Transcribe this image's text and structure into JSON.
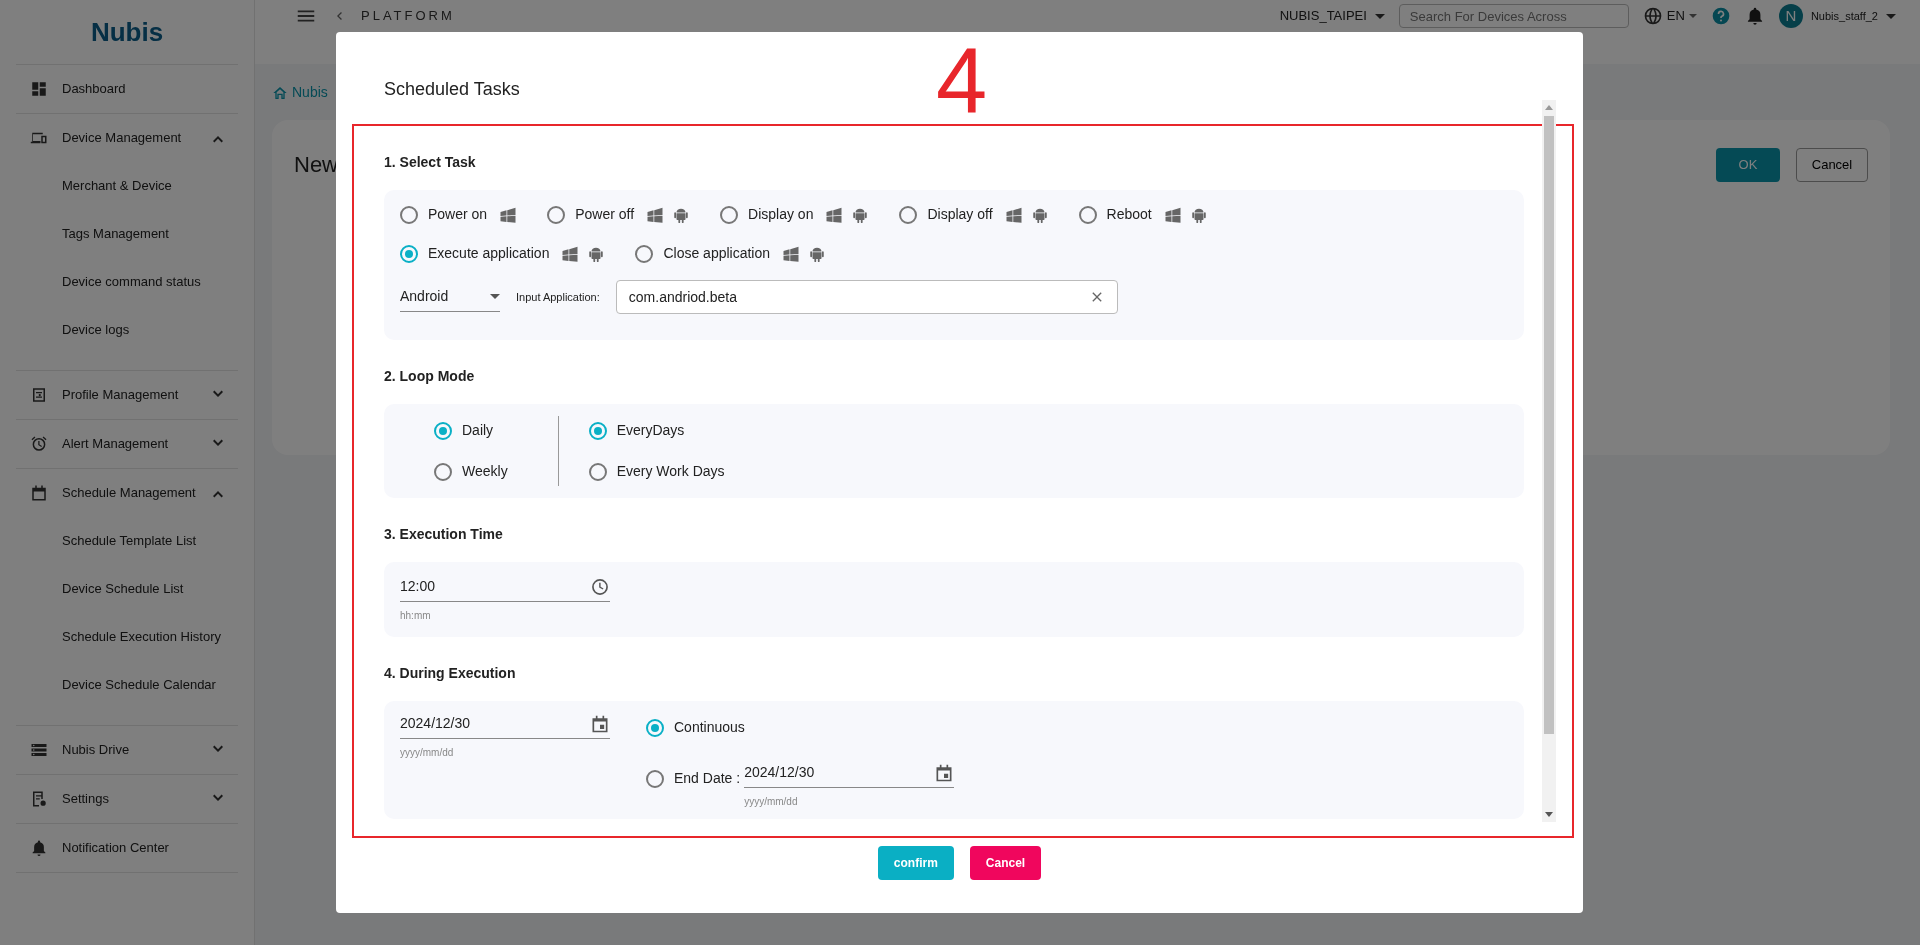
{
  "header": {
    "breadcrumb": "PLATFORM",
    "organization": "NUBIS_TAIPEI",
    "search": {
      "placeholder": "Search For Devices Across"
    },
    "language": "EN",
    "user": {
      "initial": "N",
      "name": "Nubis_staff_2"
    }
  },
  "sidebar": {
    "logo": "Nubis",
    "items": [
      {
        "label": "Dashboard"
      },
      {
        "label": "Device Management",
        "expanded": true,
        "children": [
          {
            "label": "Merchant & Device"
          },
          {
            "label": "Tags Management"
          },
          {
            "label": "Device command status"
          },
          {
            "label": "Device logs"
          }
        ]
      },
      {
        "label": "Profile Management",
        "expanded": false
      },
      {
        "label": "Alert Management",
        "expanded": false
      },
      {
        "label": "Schedule Management",
        "expanded": true,
        "children": [
          {
            "label": "Schedule Template List"
          },
          {
            "label": "Device Schedule List"
          },
          {
            "label": "Schedule Execution History"
          },
          {
            "label": "Device Schedule Calendar"
          }
        ]
      },
      {
        "label": "Nubis Drive",
        "expanded": false
      },
      {
        "label": "Settings",
        "expanded": false
      },
      {
        "label": "Notification Center"
      }
    ]
  },
  "page": {
    "breadcrumb": "Nubis",
    "title": "New",
    "buttons": [
      {
        "label": "OK",
        "kind": "primary"
      },
      {
        "label": "Cancel",
        "kind": "outline"
      }
    ]
  },
  "modal": {
    "title": "Scheduled Tasks",
    "annotation": "4",
    "select_task": {
      "heading": "1. Select Task",
      "options": [
        {
          "label": "Power on",
          "selected": false,
          "windows": true,
          "android": false
        },
        {
          "label": "Power off",
          "selected": false,
          "windows": true,
          "android": true
        },
        {
          "label": "Display on",
          "selected": false,
          "windows": true,
          "android": true
        },
        {
          "label": "Display off",
          "selected": false,
          "windows": true,
          "android": true
        },
        {
          "label": "Reboot",
          "selected": false,
          "windows": true,
          "android": true
        },
        {
          "label": "Execute application",
          "selected": true,
          "windows": true,
          "android": true
        },
        {
          "label": "Close application",
          "selected": false,
          "windows": true,
          "android": true
        }
      ],
      "platform": "Android",
      "app_label": "Input Application:",
      "app_value": "com.andriod.beta"
    },
    "loop_mode": {
      "heading": "2. Loop Mode",
      "frequency": [
        {
          "label": "Daily",
          "selected": true
        },
        {
          "label": "Weekly",
          "selected": false
        }
      ],
      "days": [
        {
          "label": "EveryDays",
          "selected": true
        },
        {
          "label": "Every Work Days",
          "selected": false
        }
      ]
    },
    "execution_time": {
      "heading": "3. Execution Time",
      "value": "12:00",
      "helper": "hh:mm"
    },
    "during_execution": {
      "heading": "4. During Execution",
      "start": {
        "value": "2024/12/30",
        "helper": "yyyy/mm/dd"
      },
      "options": [
        {
          "kind": "plain",
          "label": "Continuous",
          "selected": true
        },
        {
          "kind": "date",
          "label": "End Date :",
          "selected": false,
          "value": "2024/12/30",
          "helper": "yyyy/mm/dd"
        }
      ]
    },
    "buttons": [
      {
        "label": "confirm",
        "kind": "confirm"
      },
      {
        "label": "Cancel",
        "kind": "cancel"
      }
    ]
  }
}
